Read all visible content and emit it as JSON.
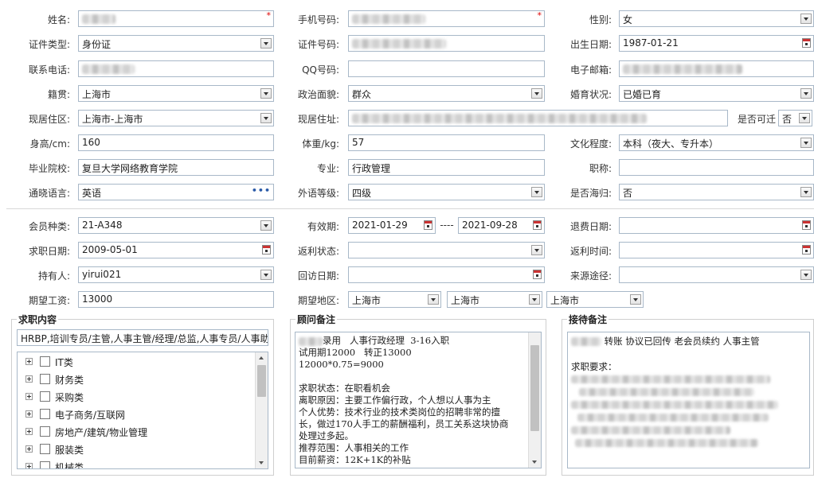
{
  "basic": {
    "name_label": "姓名:",
    "mobile_label": "手机号码:",
    "gender_label": "性别:",
    "gender_value": "女",
    "id_type_label": "证件类型:",
    "id_type_value": "身份证",
    "id_no_label": "证件号码:",
    "birth_label": "出生日期:",
    "birth_value": "1987-01-21",
    "phone_label": "联系电话:",
    "qq_label": "QQ号码:",
    "email_label": "电子邮箱:",
    "native_label": "籍贯:",
    "native_value": "上海市",
    "political_label": "政治面貌:",
    "political_value": "群众",
    "marital_label": "婚育状况:",
    "marital_value": "已婚已育",
    "residence_label": "现居住区:",
    "residence_value": "上海市-上海市",
    "address_label": "现居住址:",
    "relocate_label": "是否可迁",
    "relocate_value": "否",
    "height_label": "身高/cm:",
    "height_value": "160",
    "weight_label": "体重/kg:",
    "weight_value": "57",
    "education_label": "文化程度:",
    "education_value": "本科（夜大、专升本）",
    "school_label": "毕业院校:",
    "school_value": "复旦大学网络教育学院",
    "major_label": "专业:",
    "major_value": "行政管理",
    "title_label": "职称:",
    "language_label": "通晓语言:",
    "language_value": "英语",
    "lang_level_label": "外语等级:",
    "lang_level_value": "四级",
    "returnee_label": "是否海归:",
    "returnee_value": "否"
  },
  "member": {
    "type_label": "会员种类:",
    "type_value": "21-A348",
    "valid_label": "有效期:",
    "valid_from": "2021-01-29",
    "valid_sep": "----",
    "valid_to": "2021-09-28",
    "refund_label": "退费日期:",
    "apply_date_label": "求职日期:",
    "apply_date_value": "2009-05-01",
    "rebate_status_label": "返利状态:",
    "rebate_time_label": "返利时间:",
    "holder_label": "持有人:",
    "holder_value": "yirui021",
    "visit_label": "回访日期:",
    "source_label": "来源途径:",
    "salary_label": "期望工资:",
    "salary_value": "13000",
    "area_label": "期望地区:",
    "area_values": [
      "上海市",
      "上海市",
      "上海市"
    ]
  },
  "job_panel": {
    "title": "求职内容",
    "summary": "HRBP,培训专员/主管,人事主管/经理/总监,人事专员/人事助",
    "categories": [
      "IT类",
      "财务类",
      "采购类",
      "电子商务/互联网",
      "房地产/建筑/物业管理",
      "服装类",
      "机械类"
    ]
  },
  "advisor_panel": {
    "title": "顾问备注",
    "line1": "录用   人事行政经理  3-16入职",
    "line2": "试用期12000   转正13000",
    "line3": "12000*0.75=9000",
    "line4": "",
    "line5": "求职状态：在职看机会",
    "line6": "离职原因：主要工作偏行政，个人想以人事为主",
    "line7": "个人优势：技术行业的技术类岗位的招聘非常的擅",
    "line8": "长，做过170人手工的薪酬福利，员工关系这块协商",
    "line9": "处理过多起。",
    "line10": "推荐范围：人事相关的工作",
    "line11": "目前薪资：12K+1K的补贴"
  },
  "reception_panel": {
    "title": "接待备注",
    "line1": "转账 协议已回传 老会员续约 人事主管",
    "line2": "",
    "line3": "求职要求："
  }
}
